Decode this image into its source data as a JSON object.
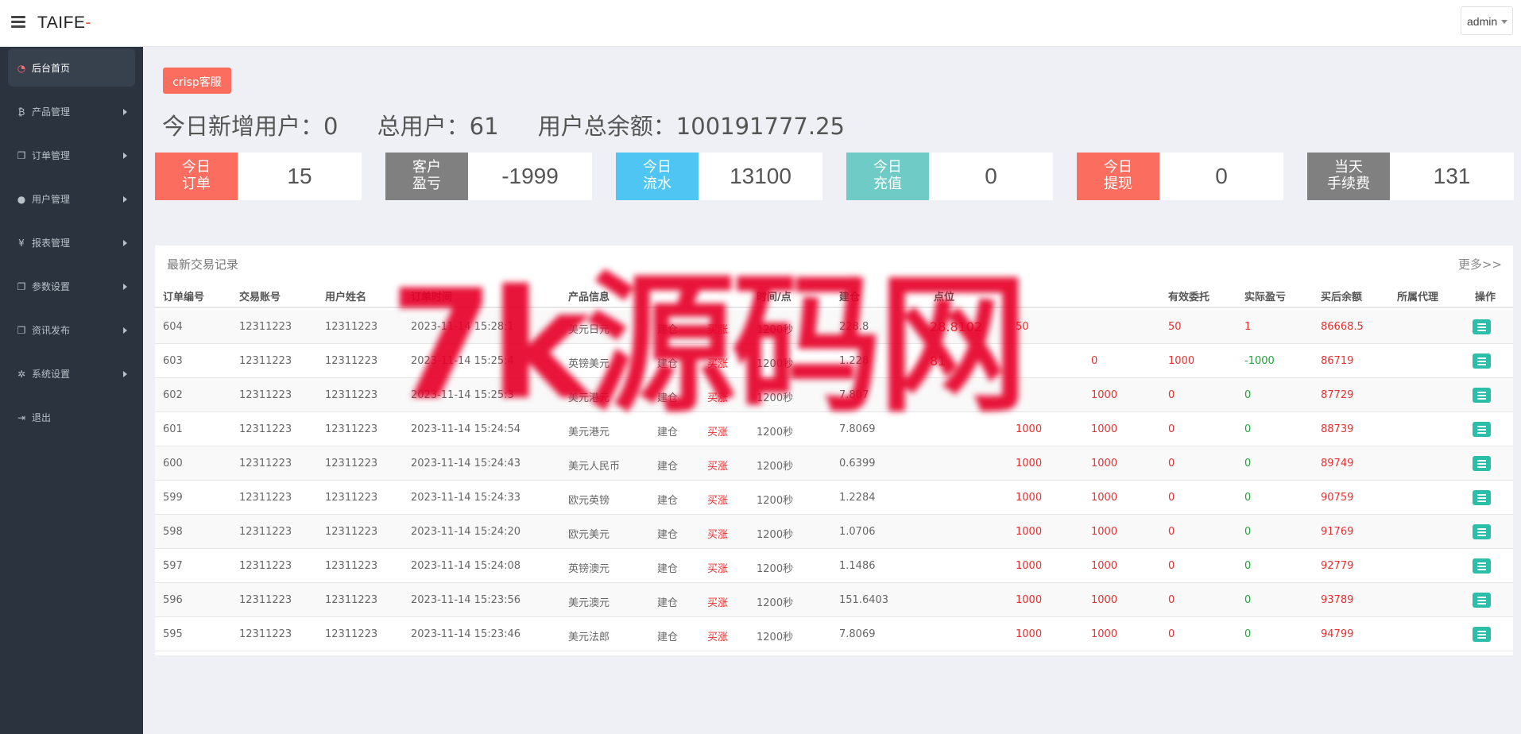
{
  "header": {
    "brand": "TAIFE",
    "brand_suffix": "-",
    "user": "admin"
  },
  "sidebar": {
    "items": [
      {
        "label": "后台首页",
        "active": true,
        "icon": "dashboard-icon"
      },
      {
        "label": "产品管理",
        "icon": "bitcoin-icon"
      },
      {
        "label": "订单管理",
        "icon": "copy-icon"
      },
      {
        "label": "用户管理",
        "icon": "user-icon"
      },
      {
        "label": "报表管理",
        "icon": "yen-icon"
      },
      {
        "label": "参数设置",
        "icon": "copy-icon"
      },
      {
        "label": "资讯发布",
        "icon": "copy-icon"
      },
      {
        "label": "系统设置",
        "icon": "gears-icon"
      },
      {
        "label": "退出",
        "icon": "sign-out-icon"
      }
    ]
  },
  "crisp_button": "crisp客服",
  "summary": {
    "new_users": "今日新增用户：0",
    "total_users": "总用户：61",
    "total_balance": "用户总余额：100191777.25"
  },
  "stats": [
    {
      "label": "今日\n订单",
      "value": "15",
      "color": "#fb6d5e"
    },
    {
      "label": "客户\n盈亏",
      "value": "-1999",
      "color": "#808080"
    },
    {
      "label": "今日\n流水",
      "value": "13100",
      "color": "#4fc5f3"
    },
    {
      "label": "今日\n充值",
      "value": "0",
      "color": "#6fcbc6"
    },
    {
      "label": "今日\n提现",
      "value": "0",
      "color": "#fb6d5e"
    },
    {
      "label": "当天\n手续费",
      "value": "131",
      "color": "#808080"
    }
  ],
  "trades": {
    "title": "最新交易记录",
    "more": "更多>>",
    "columns": [
      "订单编号",
      "交易账号",
      "用户姓名",
      "订单时间",
      "产品信息",
      "",
      "",
      "时间/点",
      "建仓",
      "",
      "点位",
      "",
      "",
      "有效委托",
      "实际盈亏",
      "买后余额",
      "所属代理",
      "操作"
    ],
    "rows": [
      [
        "604",
        "12311223",
        "12311223",
        "2023-11-14 15:28:1",
        "美元日元",
        "建仓",
        "买涨",
        "1200秒",
        "228.8",
        "28.8102",
        "50",
        "",
        "50",
        "1",
        "86668.5",
        ""
      ],
      [
        "603",
        "12311223",
        "12311223",
        "2023-11-14 15:25:4",
        "英镑美元",
        "建仓",
        "买涨",
        "1200秒",
        "1.228",
        "81",
        "",
        "0",
        "1000",
        "-1000",
        "86719",
        ""
      ],
      [
        "602",
        "12311223",
        "12311223",
        "2023-11-14 15:25:3",
        "美元港元",
        "建仓",
        "买涨",
        "1200秒",
        "7.807",
        "",
        "",
        "1000",
        "0",
        "0",
        "87729",
        ""
      ],
      [
        "601",
        "12311223",
        "12311223",
        "2023-11-14 15:24:54",
        "美元港元",
        "建仓",
        "买涨",
        "1200秒",
        "7.8069",
        "",
        "1000",
        "1000",
        "0",
        "0",
        "88739",
        ""
      ],
      [
        "600",
        "12311223",
        "12311223",
        "2023-11-14 15:24:43",
        "美元人民币",
        "建仓",
        "买涨",
        "1200秒",
        "0.6399",
        "",
        "1000",
        "1000",
        "0",
        "0",
        "89749",
        ""
      ],
      [
        "599",
        "12311223",
        "12311223",
        "2023-11-14 15:24:33",
        "欧元英镑",
        "建仓",
        "买涨",
        "1200秒",
        "1.2284",
        "",
        "1000",
        "1000",
        "0",
        "0",
        "90759",
        ""
      ],
      [
        "598",
        "12311223",
        "12311223",
        "2023-11-14 15:24:20",
        "欧元美元",
        "建仓",
        "买涨",
        "1200秒",
        "1.0706",
        "",
        "1000",
        "1000",
        "0",
        "0",
        "91769",
        ""
      ],
      [
        "597",
        "12311223",
        "12311223",
        "2023-11-14 15:24:08",
        "英镑澳元",
        "建仓",
        "买涨",
        "1200秒",
        "1.1486",
        "",
        "1000",
        "1000",
        "0",
        "0",
        "92779",
        ""
      ],
      [
        "596",
        "12311223",
        "12311223",
        "2023-11-14 15:23:56",
        "美元澳元",
        "建仓",
        "买涨",
        "1200秒",
        "151.6403",
        "",
        "1000",
        "1000",
        "0",
        "0",
        "93789",
        ""
      ],
      [
        "595",
        "12311223",
        "12311223",
        "2023-11-14 15:23:46",
        "美元法郎",
        "建仓",
        "买涨",
        "1200秒",
        "7.8069",
        "",
        "1000",
        "1000",
        "0",
        "0",
        "94799",
        ""
      ]
    ]
  },
  "watermark": "7k源码网"
}
